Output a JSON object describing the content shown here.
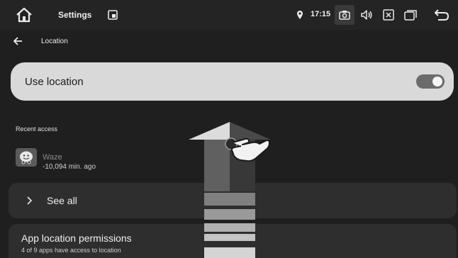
{
  "status_bar": {
    "title": "Settings",
    "time": "17:15",
    "icons": [
      "home-icon",
      "window-icon",
      "location-pin-icon",
      "camera-icon",
      "volume-icon",
      "close-box-icon",
      "recents-icon",
      "back-icon"
    ]
  },
  "header": {
    "title": "Location"
  },
  "use_location": {
    "label": "Use location",
    "enabled": true
  },
  "recent_access": {
    "heading": "Recent access",
    "items": [
      {
        "app": "Waze",
        "time": "-10,094 min. ago",
        "icon": "waze-icon"
      }
    ]
  },
  "see_all": {
    "label": "See all"
  },
  "app_permissions": {
    "title": "App location permissions",
    "subtitle": "4 of 9 apps have access to location"
  },
  "overlay": {
    "gesture": "swipe-up",
    "icons": [
      "swipe-up-arrow-icon",
      "pointing-hand-icon"
    ]
  }
}
